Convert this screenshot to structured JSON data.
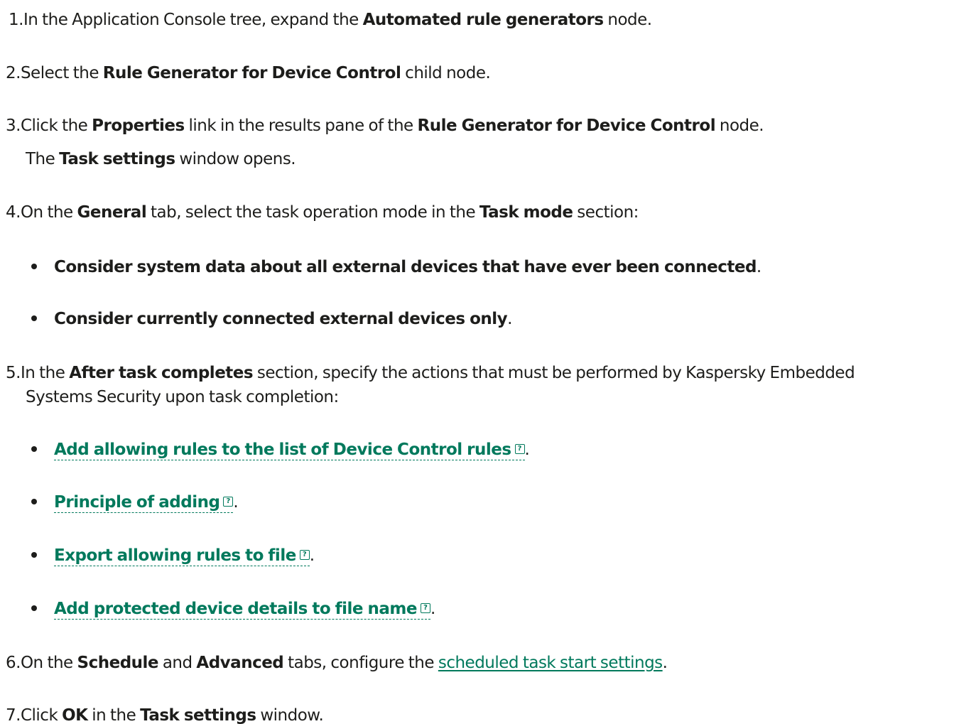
{
  "steps": {
    "s1": {
      "num": "1.",
      "t1": "In the Application Console tree, expand the ",
      "b1": "Automated rule generators",
      "t2": " node."
    },
    "s2": {
      "num": "2.",
      "t1": "Select the ",
      "b1": "Rule Generator for Device Control",
      "t2": " child node."
    },
    "s3": {
      "num": "3.",
      "t1": "Click the ",
      "b1": "Properties",
      "t2": " link in the results pane of the ",
      "b2": "Rule Generator for Device Control",
      "t3": " node."
    },
    "s3note": {
      "t1": "The ",
      "b1": "Task settings",
      "t2": " window opens."
    },
    "s4": {
      "num": "4.",
      "t1": "On the ",
      "b1": "General",
      "t2": " tab, select the task operation mode in the ",
      "b2": "Task mode",
      "t3": " section:"
    },
    "s4bullets": [
      {
        "bold": "Consider system data about all external devices that have ever been connected",
        "tail": "."
      },
      {
        "bold": "Consider currently connected external devices only",
        "tail": "."
      }
    ],
    "s5": {
      "num": "5.",
      "t1": "In the ",
      "b1": "After task completes",
      "t2": " section, specify the actions that must be performed by Kaspersky Embedded",
      "line2": "Systems Security upon task completion:"
    },
    "s5bullets": [
      {
        "link": "Add allowing rules to the list of Device Control rules",
        "tail": "."
      },
      {
        "link": "Principle of adding",
        "tail": "."
      },
      {
        "link": "Export allowing rules to file",
        "tail": "."
      },
      {
        "link": "Add protected device details to file name",
        "tail": "."
      }
    ],
    "s6": {
      "num": "6.",
      "t1": "On the ",
      "b1": "Schedule",
      "t2": " and ",
      "b2": "Advanced",
      "t3": " tabs, configure the ",
      "link": "scheduled task start settings",
      "t4": "."
    },
    "s7": {
      "num": "7.",
      "t1": "Click ",
      "b1": "OK",
      "t2": " in the ",
      "b2": "Task settings",
      "t3": " window."
    }
  },
  "icons": {
    "expand": "help-square-icon",
    "glyph": "?"
  },
  "colors": {
    "text": "#1d1d1b",
    "link": "#00795c"
  }
}
